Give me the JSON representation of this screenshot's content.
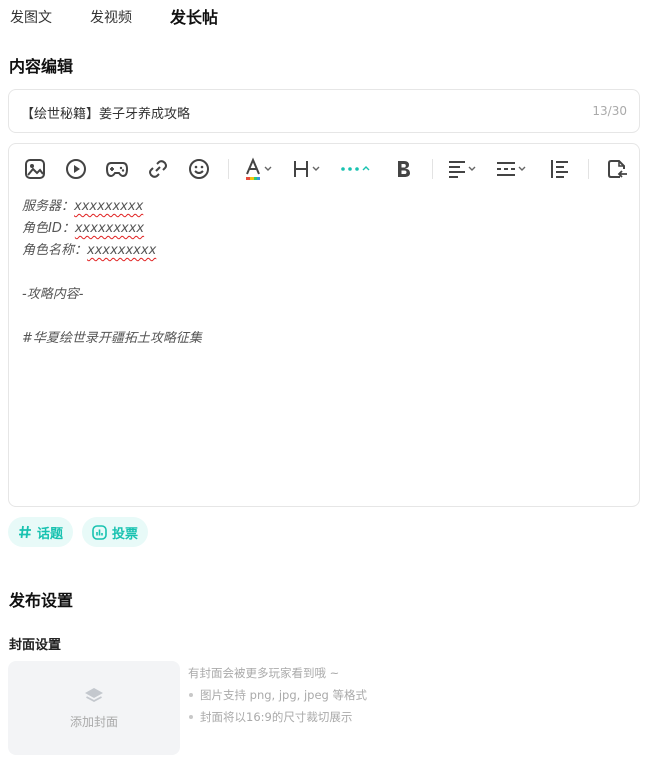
{
  "tabs": [
    {
      "label": "发图文",
      "active": false
    },
    {
      "label": "发视频",
      "active": false
    },
    {
      "label": "发长帖",
      "active": true
    }
  ],
  "content_section": {
    "title": "内容编辑",
    "title_input": {
      "value": "【绘世秘籍】姜子牙养成攻略",
      "count": "13/30"
    },
    "toolbar": {
      "items": [
        "image-icon",
        "video-icon",
        "game-icon",
        "link-icon",
        "emoji-icon",
        "font-color-icon",
        "heading-icon",
        "more-icon",
        "bold-icon",
        "align-icon",
        "divider-icon",
        "list-icon",
        "template-icon"
      ]
    },
    "body": {
      "server_label": "服务器：",
      "server_value": "xxxxxxxxx",
      "role_id_label": "角色ID：",
      "role_id_value": "xxxxxxxxx",
      "role_name_label": "角色名称：",
      "role_name_value": "xxxxxxxxx",
      "section_line": "-攻略内容-",
      "hashtag_line": "#华夏绘世录开疆拓土攻略征集"
    }
  },
  "chips": {
    "topic": "话题",
    "vote": "投票"
  },
  "publish_section": {
    "title": "发布设置",
    "cover_title": "封面设置",
    "cover_button": "添加封面",
    "tips_intro": "有封面会被更多玩家看到哦 ~",
    "tips": [
      "图片支持 png, jpg, jpeg 等格式",
      "封面将以16:9的尺寸裁切展示"
    ]
  },
  "colors": {
    "accent": "#18c2b0",
    "accent_bg": "#e8faf8",
    "tab_underline": "#2ed5c5"
  }
}
